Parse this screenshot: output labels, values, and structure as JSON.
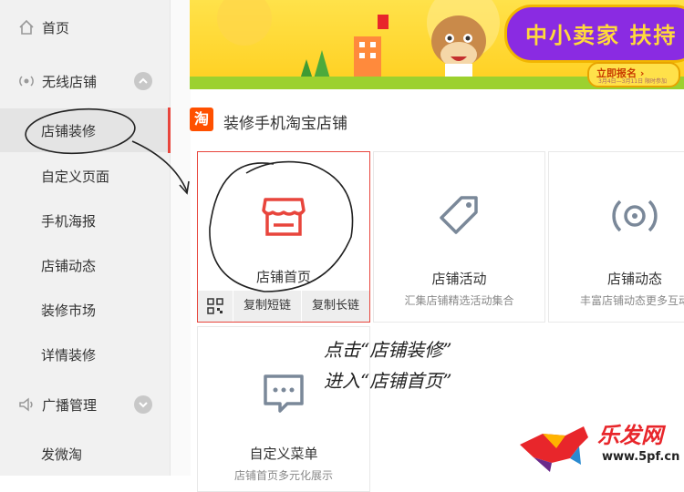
{
  "sidebar": {
    "items": [
      {
        "label": "首页",
        "icon": "home-icon"
      },
      {
        "label": "无线店铺",
        "icon": "wireless-icon"
      },
      {
        "label": "店铺装修"
      },
      {
        "label": "自定义页面"
      },
      {
        "label": "手机海报"
      },
      {
        "label": "店铺动态"
      },
      {
        "label": "装修市场"
      },
      {
        "label": "详情装修"
      },
      {
        "label": "广播管理",
        "icon": "broadcast-icon"
      },
      {
        "label": "发微淘"
      }
    ]
  },
  "banner": {
    "title": "中小卖家 扶持",
    "button": "立即报名 ›",
    "dates": "3月4日—3月11日 限时参加"
  },
  "section": {
    "logo": "淘",
    "title": "装修手机淘宝店铺"
  },
  "cards": [
    {
      "label": "店铺首页",
      "desc": "",
      "icon": "storefront-icon",
      "color": "#e8453c",
      "actions": [
        "qr-code-icon",
        "复制短链",
        "复制长链"
      ]
    },
    {
      "label": "店铺活动",
      "desc": "汇集店铺精选活动集合",
      "icon": "tag-icon",
      "color": "#7a8899"
    },
    {
      "label": "店铺动态",
      "desc": "丰富店铺动态更多互动",
      "icon": "signal-icon",
      "color": "#7a8899"
    },
    {
      "label": "自定义菜单",
      "desc": "店铺首页多元化展示",
      "icon": "chat-menu-icon",
      "color": "#7a8899"
    }
  ],
  "annotations": {
    "line1": "点击“店铺装修”",
    "line2": "进入“店铺首页”"
  },
  "watermark": {
    "title": "乐发网",
    "url": "www.5pf.cn"
  }
}
